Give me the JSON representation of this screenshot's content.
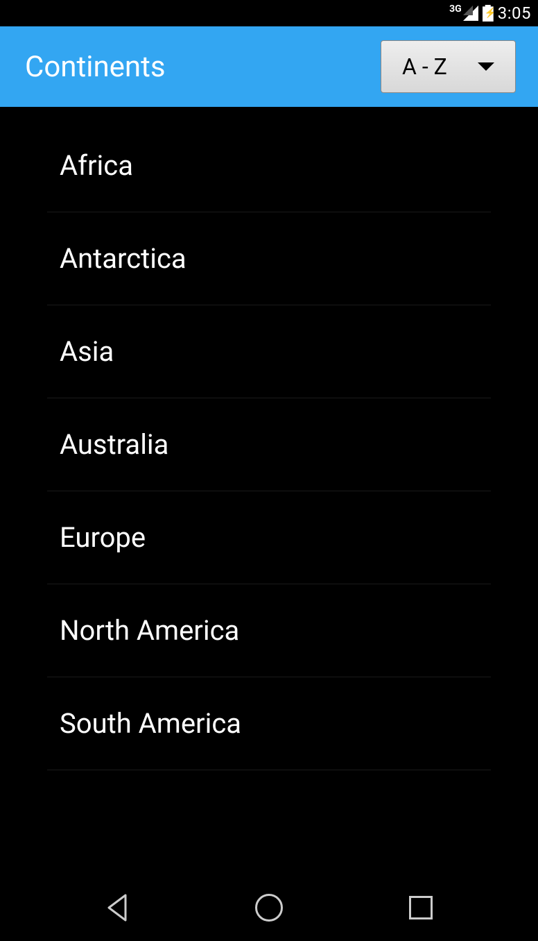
{
  "statusBar": {
    "network": "3G",
    "time": "3:05"
  },
  "appBar": {
    "title": "Continents",
    "sortLabel": "A - Z"
  },
  "list": {
    "items": [
      {
        "label": "Africa"
      },
      {
        "label": "Antarctica"
      },
      {
        "label": "Asia"
      },
      {
        "label": "Australia"
      },
      {
        "label": "Europe"
      },
      {
        "label": "North America"
      },
      {
        "label": "South America"
      }
    ]
  }
}
